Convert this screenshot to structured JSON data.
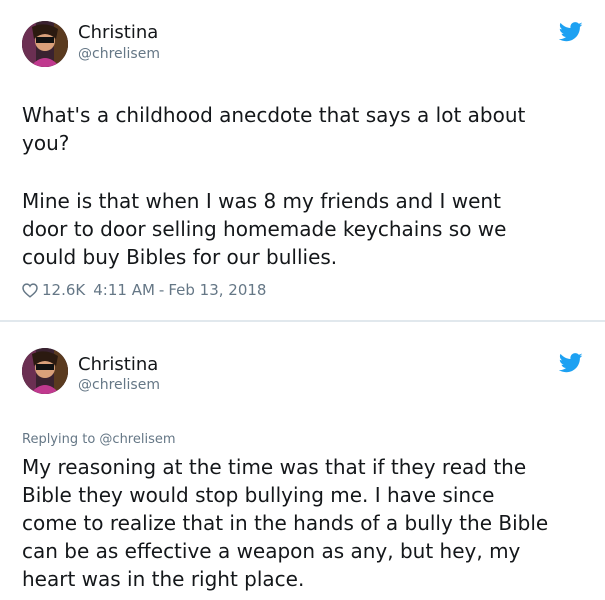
{
  "tweets": [
    {
      "author": {
        "display_name": "Christina",
        "handle": "@chrelisem"
      },
      "paragraphs": [
        [
          "What's a childhood anecdote that says a lot about",
          "you?"
        ],
        [
          "Mine is that when I was 8 my friends and I went",
          "door to door selling homemade keychains so we",
          "could buy Bibles for our bullies."
        ]
      ],
      "likes": "12.6K",
      "time": "4:11 AM",
      "separator": "-",
      "date": "Feb 13, 2018"
    },
    {
      "author": {
        "display_name": "Christina",
        "handle": "@chrelisem"
      },
      "replying_to": "Replying to @chrelisem",
      "lines": [
        "My reasoning at the time was that if they read the",
        "Bible they would stop bullying me. I have since",
        "come to realize that in the hands of a bully the Bible",
        "can be as effective a weapon as any, but hey, my",
        "heart was in the right place."
      ]
    }
  ],
  "icons": {
    "brand": "twitter-bird-icon",
    "like": "heart-outline-icon"
  },
  "colors": {
    "twitter_blue": "#1da1f2",
    "text": "#14171a",
    "secondary": "#657786",
    "divider": "#e1e8ed"
  }
}
